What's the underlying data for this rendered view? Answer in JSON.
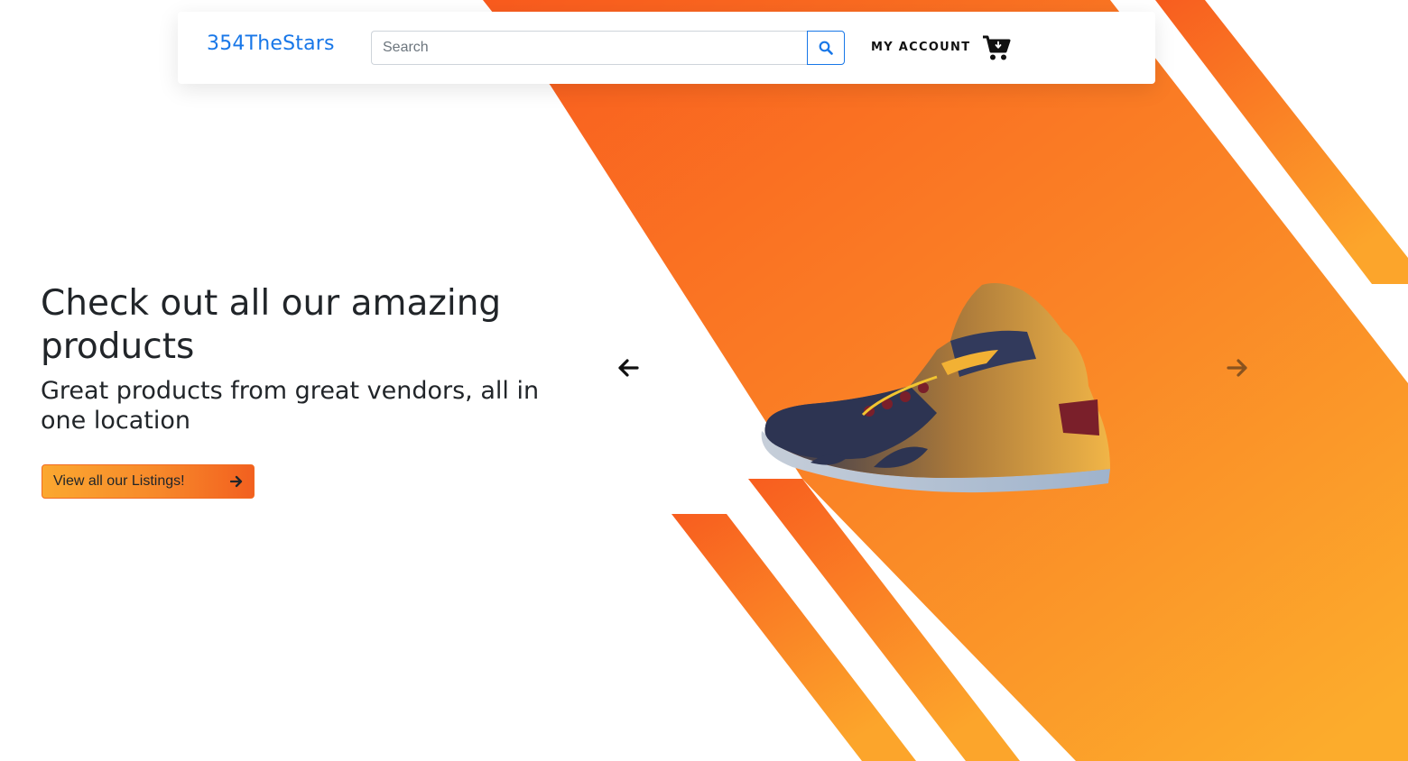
{
  "navbar": {
    "brand": "354TheStars",
    "search_placeholder": "Search",
    "search_icon": "search-icon",
    "account_label": "MY ACCOUNT",
    "cart_icon": "shopping-cart-icon"
  },
  "hero": {
    "title": "Check out all our amazing products",
    "subtitle": "Great products from great vendors, all in one location",
    "cta_label": "View all our Listings!",
    "cta_icon": "arrow-right-icon"
  },
  "carousel": {
    "prev_icon": "arrow-left-icon",
    "next_icon": "arrow-right-icon",
    "product_image": "basketball-sneaker-image"
  },
  "colors": {
    "brand": "#1877e8",
    "accent_orange": "#f7882a",
    "accent_deep_orange": "#f95f1e",
    "text": "#212529"
  }
}
